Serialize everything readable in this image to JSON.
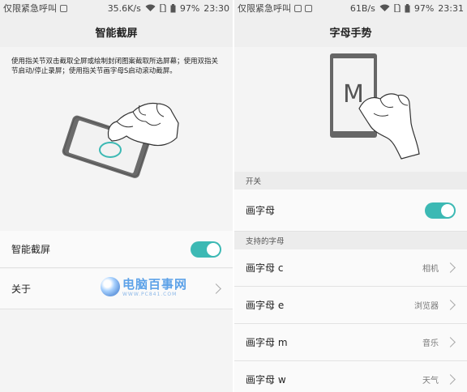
{
  "left": {
    "status": {
      "carrier": "仅限紧急呼叫",
      "speed": "35.6K/s",
      "battery": "97%",
      "time": "23:30"
    },
    "title": "智能截屏",
    "description": "使用指关节双击截取全屏或绘制封闭图案截取所选屏幕；使用双指关节启动/停止录屏；使用指关节画字母S启动滚动截屏。",
    "rows": [
      {
        "label": "智能截屏",
        "toggle_on": true
      },
      {
        "label": "关于"
      }
    ],
    "watermark": {
      "title": "电脑百事网",
      "url": "WWW.PC841.COM"
    }
  },
  "right": {
    "status": {
      "carrier": "仅限紧急呼叫",
      "speed": "61B/s",
      "battery": "97%",
      "time": "23:31"
    },
    "title": "字母手势",
    "illustration_letter": "M",
    "section_switch": "开关",
    "switch_row": {
      "label": "画字母",
      "toggle_on": true
    },
    "section_letters": "支持的字母",
    "letters": [
      {
        "label": "画字母 c",
        "value": "相机"
      },
      {
        "label": "画字母 e",
        "value": "浏览器"
      },
      {
        "label": "画字母 m",
        "value": "音乐"
      },
      {
        "label": "画字母 w",
        "value": "天气"
      }
    ]
  },
  "colors": {
    "accent": "#3cb9b4",
    "watermark": "#5da2e8"
  }
}
